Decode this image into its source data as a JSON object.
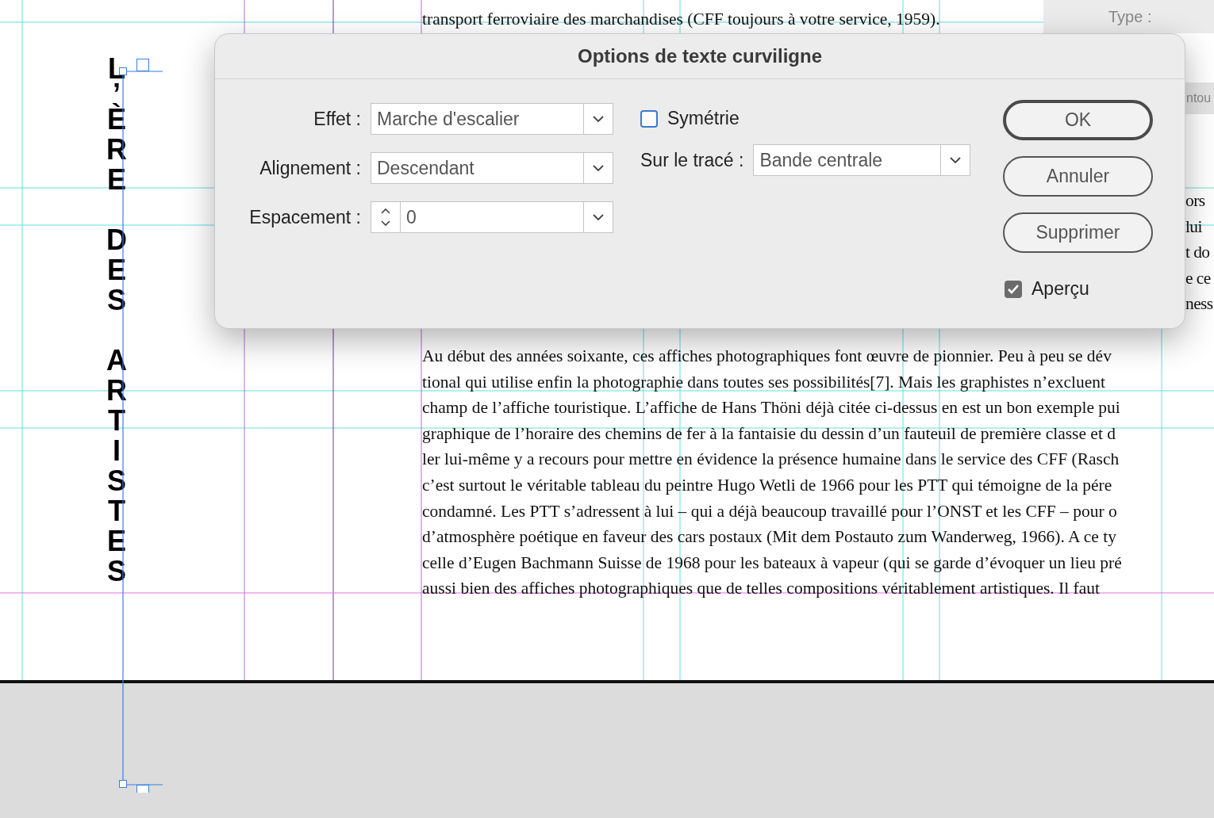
{
  "document": {
    "vertical_title": "L’ÈRE DES ARTISTES",
    "top_line": "transport ferroviaire des marchandises (CFF toujours à votre service, 1959).",
    "right_fragments": [
      "ors",
      "lui",
      "t do",
      "e ce",
      "ness"
    ],
    "lines": [
      "Au début des années soixante, ces affiches photographiques font œuvre de pionnier. Peu à peu se dév",
      "tional qui utilise enfin la photographie dans toutes ses possibilités[7]. Mais les graphistes n’excluent",
      "champ de l’affiche touristique. L’affiche de Hans Thöni déjà citée ci-dessus en est un bon exemple pui",
      "graphique de l’horaire des chemins de fer à la fantaisie du dessin d’un fauteuil de première classe et d",
      "ler lui-même y a recours pour mettre en évidence la présence humaine dans le service des CFF (Rasch",
      "c’est surtout le véritable tableau du peintre Hugo Wetli de 1966 pour les PTT qui témoigne de la pére",
      "condamné. Les PTT s’adressent à lui – qui a déjà beaucoup travaillé pour l’ONST et les CFF – pour o",
      "d’atmosphère poétique en faveur des cars postaux (Mit dem Postauto zum Wanderweg, 1966). A ce ty",
      "celle d’Eugen Bachmann Suisse de 1968 pour les bateaux à vapeur (qui se garde d’évoquer un lieu pré",
      "aussi bien des affiches photographiques que de telles compositions véritablement artistiques. Il faut"
    ]
  },
  "panels": {
    "type_label": "Type :",
    "partial_label": "ntou"
  },
  "dialog": {
    "title": "Options de texte curviligne",
    "fields": [
      {
        "label": "Effet :",
        "value": "Marche d'escalier",
        "kind": "dropdown"
      },
      {
        "label": "Alignement :",
        "value": "Descendant",
        "kind": "dropdown"
      },
      {
        "label": "Espacement :",
        "value": "0",
        "kind": "stepper"
      }
    ],
    "symmetry": {
      "label": "Symétrie",
      "checked": false
    },
    "path_field": {
      "label": "Sur le tracé :",
      "value": "Bande centrale"
    },
    "buttons": [
      {
        "label": "OK",
        "default": true
      },
      {
        "label": "Annuler",
        "default": false
      },
      {
        "label": "Supprimer",
        "default": false
      }
    ],
    "preview": {
      "label": "Aperçu",
      "checked": true
    }
  }
}
